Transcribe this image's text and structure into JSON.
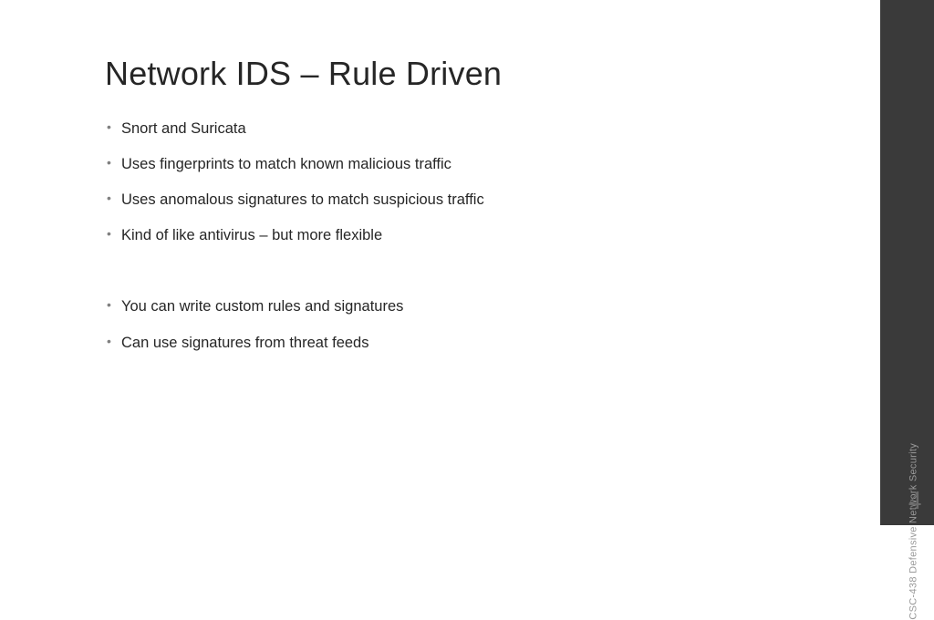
{
  "title": "Network IDS – Rule Driven",
  "bullets": [
    "Snort and Suricata",
    "Uses fingerprints to match known malicious traffic",
    "Uses anomalous signatures to match suspicious traffic",
    "Kind of like antivirus – but more flexible",
    "",
    "You can write custom rules and signatures",
    "Can use signatures from threat feeds"
  ],
  "course_label": "CSC-438 Defensive Network Security",
  "page_number": "4"
}
